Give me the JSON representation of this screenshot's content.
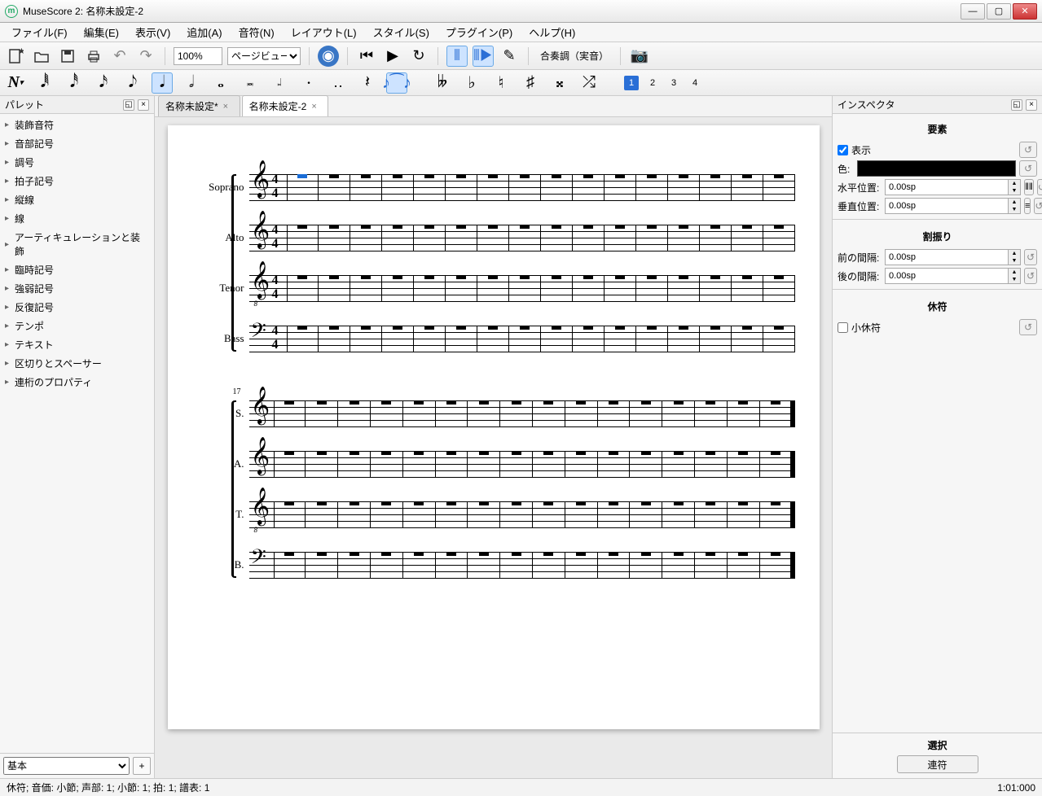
{
  "window": {
    "title": "MuseScore 2: 名称未設定-2"
  },
  "menubar": [
    "ファイル(F)",
    "編集(E)",
    "表示(V)",
    "追加(A)",
    "音符(N)",
    "レイアウト(L)",
    "スタイル(S)",
    "プラグイン(P)",
    "ヘルプ(H)"
  ],
  "toolbar1": {
    "zoom": "100%",
    "viewmode": "ページビュー",
    "concert_pitch": "合奏調（実音）"
  },
  "note_toolbar": {
    "voices": [
      "1",
      "2",
      "3",
      "4"
    ],
    "active_voice": 0
  },
  "palette": {
    "title": "パレット",
    "items": [
      "装飾音符",
      "音部記号",
      "調号",
      "拍子記号",
      "縦線",
      "線",
      "アーティキュレーションと装飾",
      "臨時記号",
      "強弱記号",
      "反復記号",
      "テンポ",
      "テキスト",
      "区切りとスペーサー",
      "連桁のプロパティ"
    ],
    "preset": "基本"
  },
  "tabs": [
    {
      "label": "名称未設定*",
      "active": false
    },
    {
      "label": "名称未設定-2",
      "active": true
    }
  ],
  "score": {
    "system1": {
      "parts": [
        "Soprano",
        "Alto",
        "Tenor",
        "Bass"
      ],
      "measures": 16,
      "timesig_top": "4",
      "timesig_bottom": "4",
      "selected_rest": {
        "part": 0,
        "measure": 0
      }
    },
    "system2": {
      "start_measure": "17",
      "parts": [
        "S.",
        "A.",
        "T.",
        "B."
      ],
      "measures": 16
    }
  },
  "inspector": {
    "title": "インスペクタ",
    "section_element": "要素",
    "visible_label": "表示",
    "color_label": "色:",
    "hpos_label": "水平位置:",
    "vpos_label": "垂直位置:",
    "hpos_value": "0.00sp",
    "vpos_value": "0.00sp",
    "section_segment": "割振り",
    "leading_label": "前の間隔:",
    "trailing_label": "後の間隔:",
    "leading_value": "0.00sp",
    "trailing_value": "0.00sp",
    "section_rest": "休符",
    "small_label": "小休符",
    "selection_title": "選択",
    "selection_button": "連符"
  },
  "statusbar": {
    "left": "休符; 音価: 小節; 声部: 1; 小節: 1; 拍: 1; 譜表: 1",
    "right": "1:01:000"
  }
}
